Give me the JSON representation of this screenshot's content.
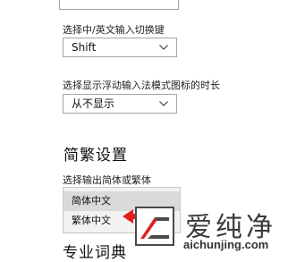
{
  "settings": {
    "switch_key": {
      "label": "选择中/英文输入切换键",
      "value": "Shift"
    },
    "float_duration": {
      "label": "选择显示浮动输入法模式图标的时长",
      "value": "从不显示"
    }
  },
  "section": {
    "title": "简繁设置",
    "output_label": "选择输出简体或繁体",
    "options": [
      "简体中文",
      "繁体中文"
    ],
    "selected_index": 0
  },
  "next_section": {
    "title_partial": "专业词典"
  },
  "watermark": {
    "brand": "爱纯净",
    "url": "aichunjing.com"
  },
  "colors": {
    "arrow": "#e02020",
    "border": "#a5a5a5",
    "dropdown_bg": "#f2f2f2",
    "selected_bg": "#dadada"
  },
  "icons": [
    "chevron-down-icon",
    "red-arrow-icon",
    "watermark-logo-icon"
  ]
}
